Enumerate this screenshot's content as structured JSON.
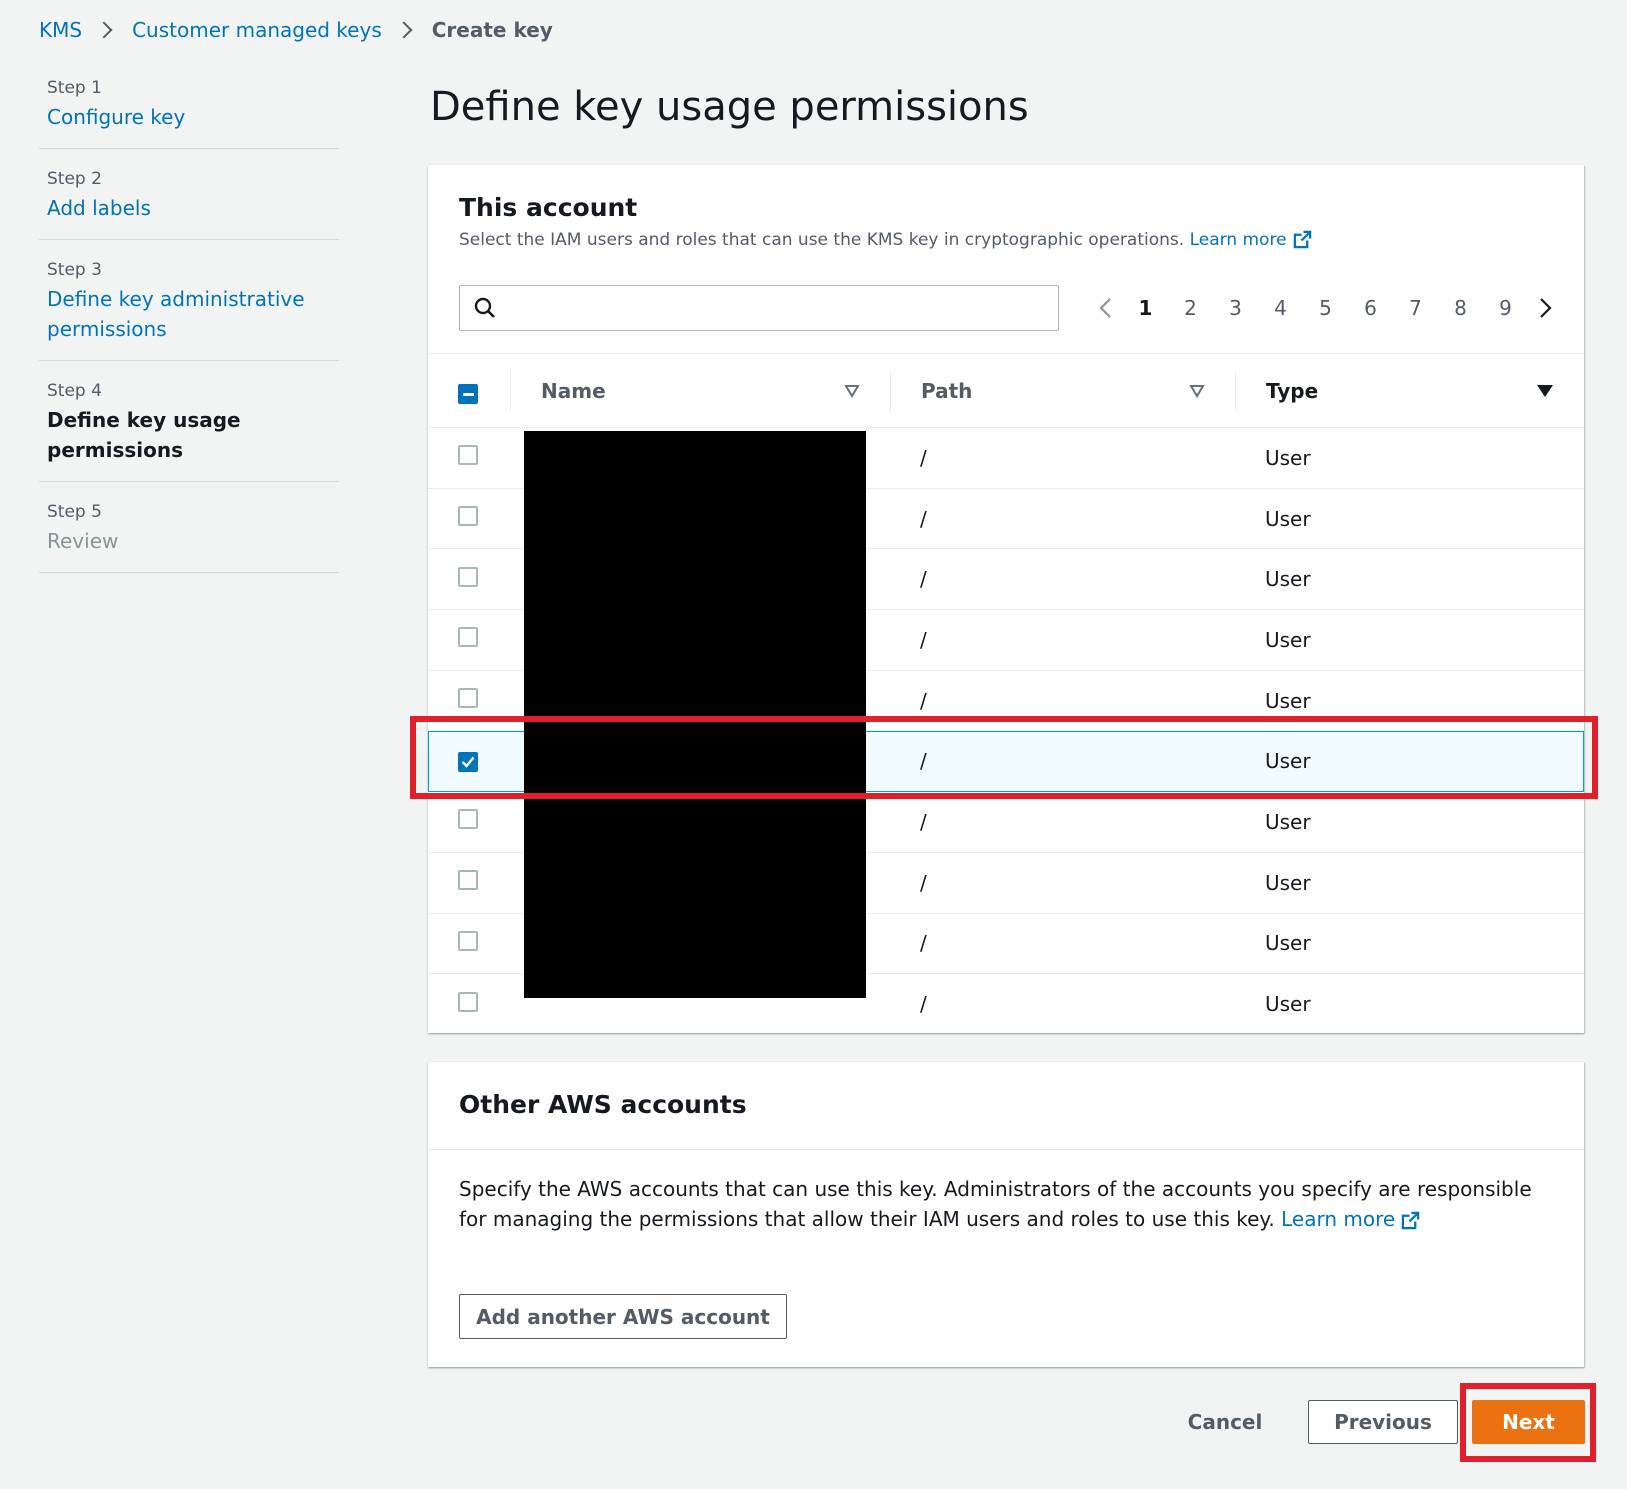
{
  "breadcrumb": [
    "KMS",
    "Customer managed keys",
    "Create key"
  ],
  "steps": [
    {
      "num": "Step 1",
      "label": "Configure key"
    },
    {
      "num": "Step 2",
      "label": "Add labels"
    },
    {
      "num": "Step 3",
      "label": "Define key administrative permissions"
    },
    {
      "num": "Step 4",
      "label": "Define key usage permissions"
    },
    {
      "num": "Step 5",
      "label": "Review"
    }
  ],
  "page_title": "Define key usage permissions",
  "this_account": {
    "title": "This account",
    "description": "Select the IAM users and roles that can use the KMS key in cryptographic operations.",
    "learn_more": "Learn more",
    "search_placeholder": "",
    "pages": [
      "1",
      "2",
      "3",
      "4",
      "5",
      "6",
      "7",
      "8",
      "9"
    ],
    "current_page": "1",
    "columns": {
      "name": "Name",
      "path": "Path",
      "type": "Type"
    },
    "rows": [
      {
        "path": "/",
        "type": "User",
        "checked": false
      },
      {
        "path": "/",
        "type": "User",
        "checked": false
      },
      {
        "path": "/",
        "type": "User",
        "checked": false
      },
      {
        "path": "/",
        "type": "User",
        "checked": false
      },
      {
        "path": "/",
        "type": "User",
        "checked": false
      },
      {
        "path": "/",
        "type": "User",
        "checked": true
      },
      {
        "path": "/",
        "type": "User",
        "checked": false
      },
      {
        "path": "/",
        "type": "User",
        "checked": false
      },
      {
        "path": "/",
        "type": "User",
        "checked": false
      },
      {
        "path": "/",
        "type": "User",
        "checked": false
      }
    ]
  },
  "other_accounts": {
    "title": "Other AWS accounts",
    "description": "Specify the AWS accounts that can use this key. Administrators of the accounts you specify are responsible for managing the permissions that allow their IAM users and roles to use this key.",
    "learn_more": "Learn more",
    "add_button": "Add another AWS account"
  },
  "footer": {
    "cancel": "Cancel",
    "previous": "Previous",
    "next": "Next"
  },
  "colors": {
    "link": "#0073bb",
    "primary_button": "#ec7211",
    "highlight": "#e0202a",
    "selected_row": "#f1faff"
  }
}
